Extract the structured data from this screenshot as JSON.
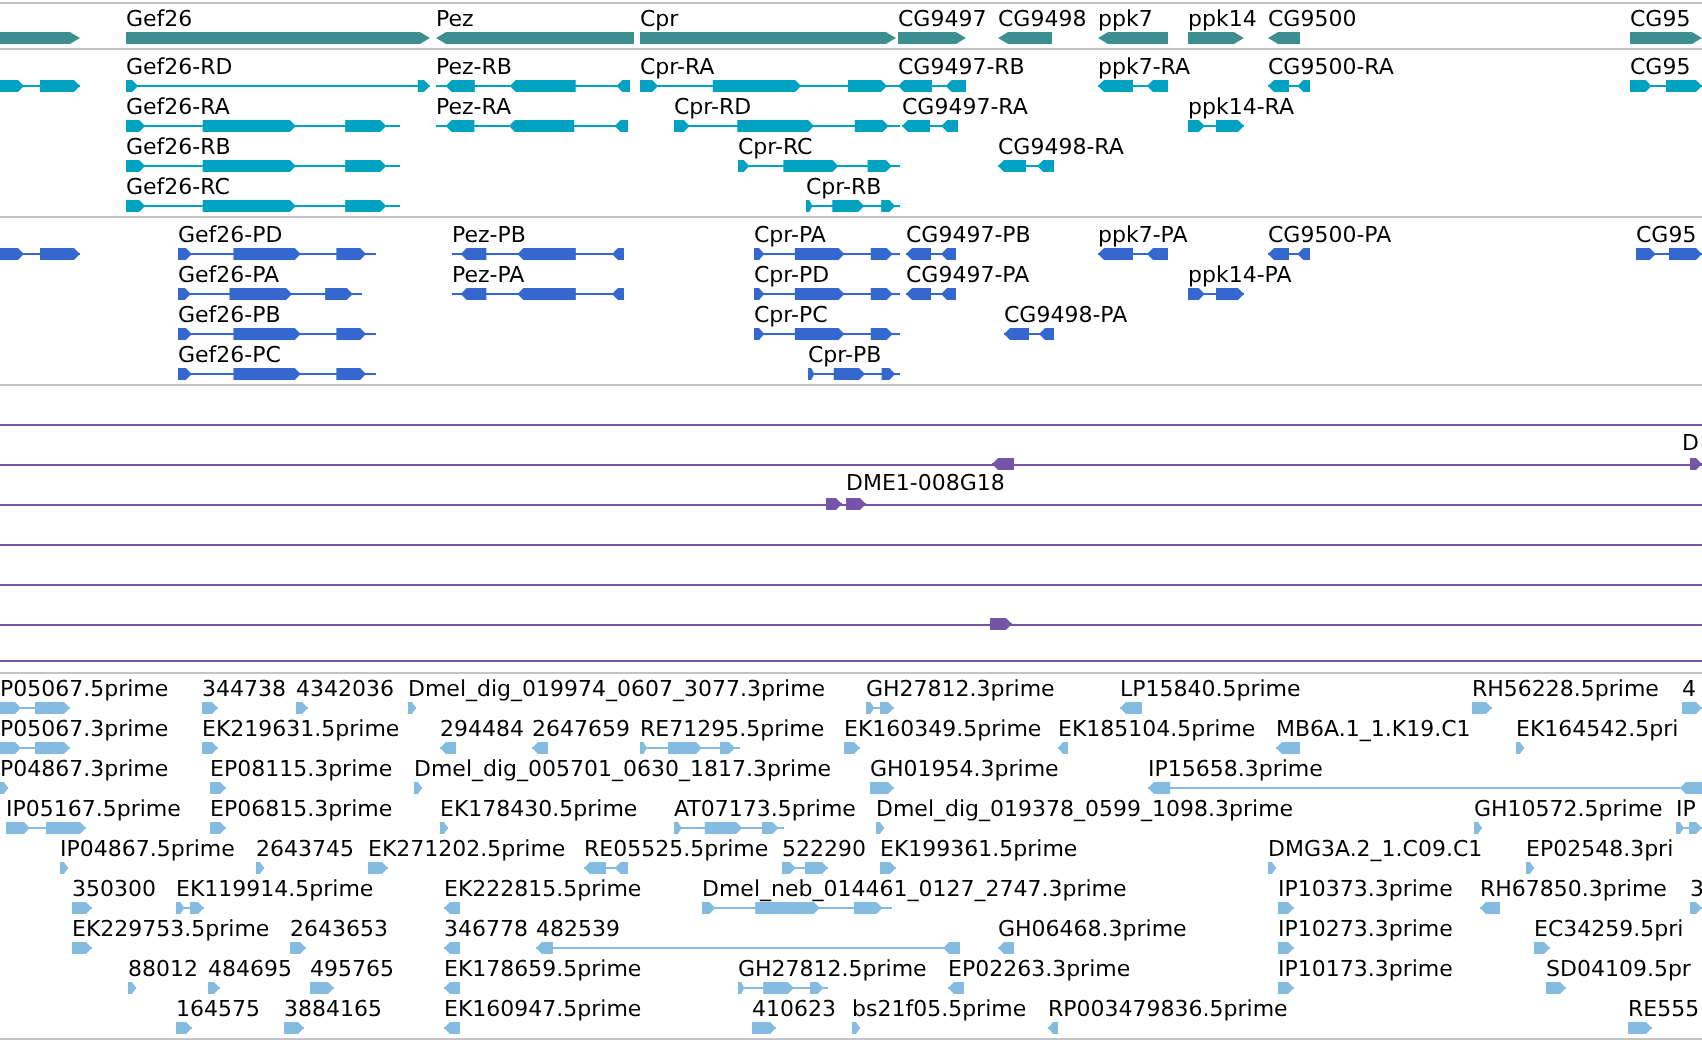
{
  "tracks": [
    {
      "kind": "gene",
      "rows": [
        {
          "features": [
            {
              "reverse": false
            },
            {
              "label": "Gef26",
              "reverse": false
            },
            {
              "label": "Pez",
              "reverse": true
            },
            {
              "label": "Cpr",
              "reverse": false
            },
            {
              "label": "CG9497",
              "reverse": false
            },
            {
              "label": "CG9498",
              "reverse": true
            },
            {
              "label": "ppk7",
              "reverse": true
            },
            {
              "label": "ppk14",
              "reverse": false
            },
            {
              "label": "CG9500",
              "reverse": true
            },
            {
              "label": "CG95",
              "reverse": false
            }
          ]
        }
      ]
    },
    {
      "kind": "transcript",
      "rows": [
        {
          "features": [
            {
              "reverse": false
            },
            {
              "label": "Gef26-RD",
              "reverse": false
            },
            {
              "label": "Pez-RB",
              "reverse": true
            },
            {
              "label": "Cpr-RA",
              "reverse": false
            },
            {
              "label": "CG9497-RB",
              "reverse": true
            },
            {
              "label": "ppk7-RA",
              "reverse": true
            },
            {
              "label": "CG9500-RA",
              "reverse": true
            },
            {
              "label": "CG95",
              "reverse": false
            }
          ]
        },
        {
          "features": [
            {
              "label": "Gef26-RA",
              "reverse": false
            },
            {
              "label": "Pez-RA",
              "reverse": true
            },
            {
              "label": "Cpr-RD",
              "reverse": false
            },
            {
              "label": "CG9497-RA",
              "reverse": true
            },
            {
              "label": "ppk14-RA",
              "reverse": false
            }
          ]
        },
        {
          "features": [
            {
              "label": "Gef26-RB",
              "reverse": false
            },
            {
              "label": "Cpr-RC",
              "reverse": false
            },
            {
              "label": "CG9498-RA",
              "reverse": true
            }
          ]
        },
        {
          "features": [
            {
              "label": "Gef26-RC",
              "reverse": false
            },
            {
              "label": "Cpr-RB",
              "reverse": false
            }
          ]
        }
      ]
    },
    {
      "kind": "protein",
      "rows": [
        {
          "features": [
            {
              "reverse": false
            },
            {
              "label": "Gef26-PD",
              "reverse": false
            },
            {
              "label": "Pez-PB",
              "reverse": true
            },
            {
              "label": "Cpr-PA",
              "reverse": false
            },
            {
              "label": "CG9497-PB",
              "reverse": true
            },
            {
              "label": "ppk7-PA",
              "reverse": true
            },
            {
              "label": "CG9500-PA",
              "reverse": true
            },
            {
              "label": "CG95",
              "reverse": false
            }
          ]
        },
        {
          "features": [
            {
              "label": "Gef26-PA",
              "reverse": false
            },
            {
              "label": "Pez-PA",
              "reverse": true
            },
            {
              "label": "Cpr-PD",
              "reverse": false
            },
            {
              "label": "CG9497-PA",
              "reverse": true
            },
            {
              "label": "ppk14-PA",
              "reverse": false
            }
          ]
        },
        {
          "features": [
            {
              "label": "Gef26-PB",
              "reverse": false
            },
            {
              "label": "Cpr-PC",
              "reverse": false
            },
            {
              "label": "CG9498-PA",
              "reverse": true
            }
          ]
        },
        {
          "features": [
            {
              "label": "Gef26-PC",
              "reverse": false
            },
            {
              "label": "Cpr-PB",
              "reverse": false
            }
          ]
        }
      ]
    },
    {
      "kind": "clone",
      "rows": [
        {},
        {
          "features": [
            {
              "reverse": true
            },
            {
              "label": "D",
              "reverse": false
            }
          ]
        },
        {
          "features": [
            {
              "reverse": false
            },
            {
              "label": "DME1-008G18",
              "reverse": false
            }
          ]
        },
        {},
        {},
        {
          "features": [
            {
              "reverse": false
            }
          ]
        }
      ]
    },
    {
      "kind": "est",
      "rows": [
        {
          "features": [
            {
              "label": "P05067.5prime",
              "reverse": false
            },
            {
              "label": "344738",
              "reverse": false
            },
            {
              "label": "4342036",
              "reverse": false
            },
            {
              "label": "Dmel_dig_019974_0607_3077.3prime",
              "reverse": false
            },
            {
              "label": "GH27812.3prime",
              "reverse": false
            },
            {
              "label": "LP15840.5prime",
              "reverse": true
            },
            {
              "label": "RH56228.5prime",
              "reverse": false
            },
            {
              "label": "4",
              "reverse": false
            }
          ]
        },
        {
          "features": [
            {
              "label": "P05067.3prime",
              "reverse": false
            },
            {
              "label": "EK219631.5prime",
              "reverse": false
            },
            {
              "label": "294484",
              "reverse": true
            },
            {
              "label": "2647659",
              "reverse": true
            },
            {
              "label": "RE71295.5prime",
              "reverse": false
            },
            {
              "label": "EK160349.5prime",
              "reverse": false
            },
            {
              "label": "EK185104.5prime",
              "reverse": true
            },
            {
              "label": "MB6A.1_1.K19.C1",
              "reverse": true
            },
            {
              "label": "EK164542.5pri",
              "reverse": false
            }
          ]
        },
        {
          "features": [
            {
              "label": "P04867.3prime",
              "reverse": false
            },
            {
              "label": "EP08115.3prime",
              "reverse": false
            },
            {
              "label": "Dmel_dig_005701_0630_1817.3prime",
              "reverse": false
            },
            {
              "label": "GH01954.3prime",
              "reverse": false
            },
            {
              "label": "IP15658.3prime",
              "reverse": true
            }
          ]
        },
        {
          "features": [
            {
              "label": "IP05167.5prime",
              "reverse": false
            },
            {
              "label": "EP06815.3prime",
              "reverse": false
            },
            {
              "label": "EK178430.5prime",
              "reverse": false
            },
            {
              "label": "AT07173.5prime",
              "reverse": false
            },
            {
              "label": "Dmel_dig_019378_0599_1098.3prime",
              "reverse": false
            },
            {
              "label": "GH10572.5prime",
              "reverse": false
            },
            {
              "label": "IP",
              "reverse": false
            }
          ]
        },
        {
          "features": [
            {
              "label": "IP04867.5prime",
              "reverse": false
            },
            {
              "label": "2643745",
              "reverse": false
            },
            {
              "label": "EK271202.5prime",
              "reverse": false
            },
            {
              "label": "RE05525.5prime",
              "reverse": true
            },
            {
              "label": "522290",
              "reverse": false
            },
            {
              "label": "EK199361.5prime",
              "reverse": false
            },
            {
              "label": "DMG3A.2_1.C09.C1",
              "reverse": false
            },
            {
              "label": "EP02548.3pri",
              "reverse": false
            }
          ]
        },
        {
          "features": [
            {
              "label": "350300",
              "reverse": false
            },
            {
              "label": "EK119914.5prime",
              "reverse": false
            },
            {
              "label": "EK222815.5prime",
              "reverse": true
            },
            {
              "label": "Dmel_neb_014461_0127_2747.3prime",
              "reverse": false
            },
            {
              "label": "IP10373.3prime",
              "reverse": false
            },
            {
              "label": "RH67850.3prime",
              "reverse": true
            },
            {
              "label": "3",
              "reverse": false
            }
          ]
        },
        {
          "features": [
            {
              "label": "EK229753.5prime",
              "reverse": false
            },
            {
              "label": "2643653",
              "reverse": false
            },
            {
              "label": "346778",
              "reverse": true
            },
            {
              "label": "482539",
              "reverse": true
            },
            {
              "label": "GH06468.3prime",
              "reverse": true
            },
            {
              "label": "IP10273.3prime",
              "reverse": false
            },
            {
              "label": "EC34259.5pri",
              "reverse": false
            }
          ]
        },
        {
          "features": [
            {
              "label": "88012",
              "reverse": false
            },
            {
              "label": "484695",
              "reverse": false
            },
            {
              "label": "495765",
              "reverse": false
            },
            {
              "label": "EK178659.5prime",
              "reverse": true
            },
            {
              "label": "GH27812.5prime",
              "reverse": false
            },
            {
              "label": "EP02263.3prime",
              "reverse": true
            },
            {
              "label": "IP10173.3prime",
              "reverse": false
            },
            {
              "label": "SD04109.5pr",
              "reverse": false
            }
          ]
        },
        {
          "features": [
            {
              "label": "164575",
              "reverse": false
            },
            {
              "label": "3884165",
              "reverse": false
            },
            {
              "label": "EK160947.5prime",
              "reverse": true
            },
            {
              "label": "410623",
              "reverse": false
            },
            {
              "label": "bs21f05.5prime",
              "reverse": false
            },
            {
              "label": "RP003479836.5prime",
              "reverse": true
            },
            {
              "label": "RE555",
              "reverse": false
            }
          ]
        }
      ]
    }
  ]
}
